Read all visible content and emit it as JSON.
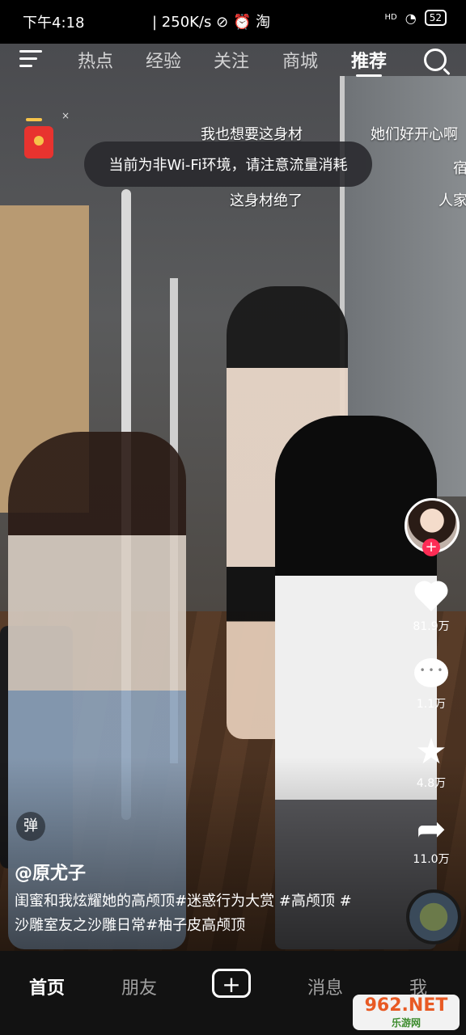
{
  "status_bar": {
    "time": "下午4:18",
    "speed": "250K/s",
    "icons": "⊘ ⏰ 淘",
    "network": "HD",
    "wifi": "📶",
    "battery": "52"
  },
  "top_nav": {
    "tabs": [
      "热点",
      "经验",
      "关注",
      "商城",
      "推荐"
    ],
    "active_tab": "推荐"
  },
  "red_packet": {
    "close": "×"
  },
  "danmaku": [
    "我也想要这身材",
    "她们好开心啊",
    "宿",
    "这身材绝了",
    "人家"
  ],
  "toast": {
    "text": "当前为非Wi-Fi环境，请注意流量消耗"
  },
  "right_rail": {
    "follow": "+",
    "likes": "81.9万",
    "comments": "1.1万",
    "favorites": "4.8万",
    "shares": "11.0万"
  },
  "video_info": {
    "danmu_toggle": "弹",
    "author": "@原尤子",
    "caption": "闺蜜和我炫耀她的高颅顶#迷惑行为大赏 #高颅顶 #沙雕室友之沙雕日常#柚子皮高颅顶"
  },
  "bottom_nav": {
    "items": [
      "首页",
      "朋友",
      "+",
      "消息",
      "我"
    ]
  },
  "watermark": {
    "main": "962.NET",
    "sub": "乐游网"
  }
}
